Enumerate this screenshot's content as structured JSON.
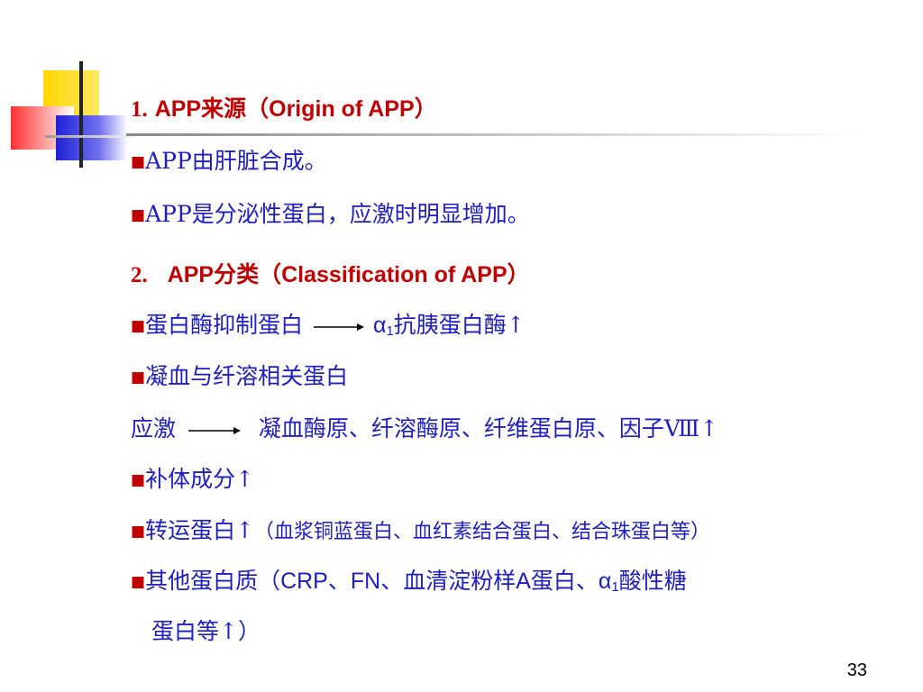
{
  "slide": {
    "page_number": "33",
    "sections": [
      {
        "number": "1.",
        "title_app": "APP",
        "title_cn": "来源",
        "title_en": "（Origin of APP）",
        "bullets": [
          "APP由肝脏合成。",
          "APP是分泌性蛋白，应激时明显增加。"
        ]
      },
      {
        "number": "2.",
        "title_app": "APP",
        "title_cn": "分类",
        "title_en": "（Classification of APP）"
      }
    ],
    "items": {
      "protease_left": "蛋白酶抑制蛋白",
      "protease_alpha": "α",
      "protease_sub": "1",
      "protease_right": "抗胰蛋白酶↑",
      "coag": "凝血与纤溶相关蛋白",
      "stress_left": "应激",
      "stress_right": "凝血酶原、纤溶酶原、纤维蛋白原、因子Ⅷ↑",
      "complement": "补体成分↑",
      "transport_main": "转运蛋白↑",
      "transport_detail": "（血浆铜蓝蛋白、血红素结合蛋白、结合珠蛋白等）",
      "other_a": "其他蛋白质（",
      "other_b": "CRP、FN",
      "other_c": "、血清淀粉样",
      "other_d": "A",
      "other_e": "蛋白、",
      "other_alpha": "α",
      "other_sub": "1",
      "other_f": "酸性糖",
      "other_line2": "蛋白等↑）"
    },
    "bullet_symbol": "■",
    "colors": {
      "text": "#1e1ebe",
      "heading": "#c00000",
      "deco_yellow": "#ffd700",
      "deco_blue": "#3a3ae0",
      "deco_red": "#ff4040"
    }
  }
}
